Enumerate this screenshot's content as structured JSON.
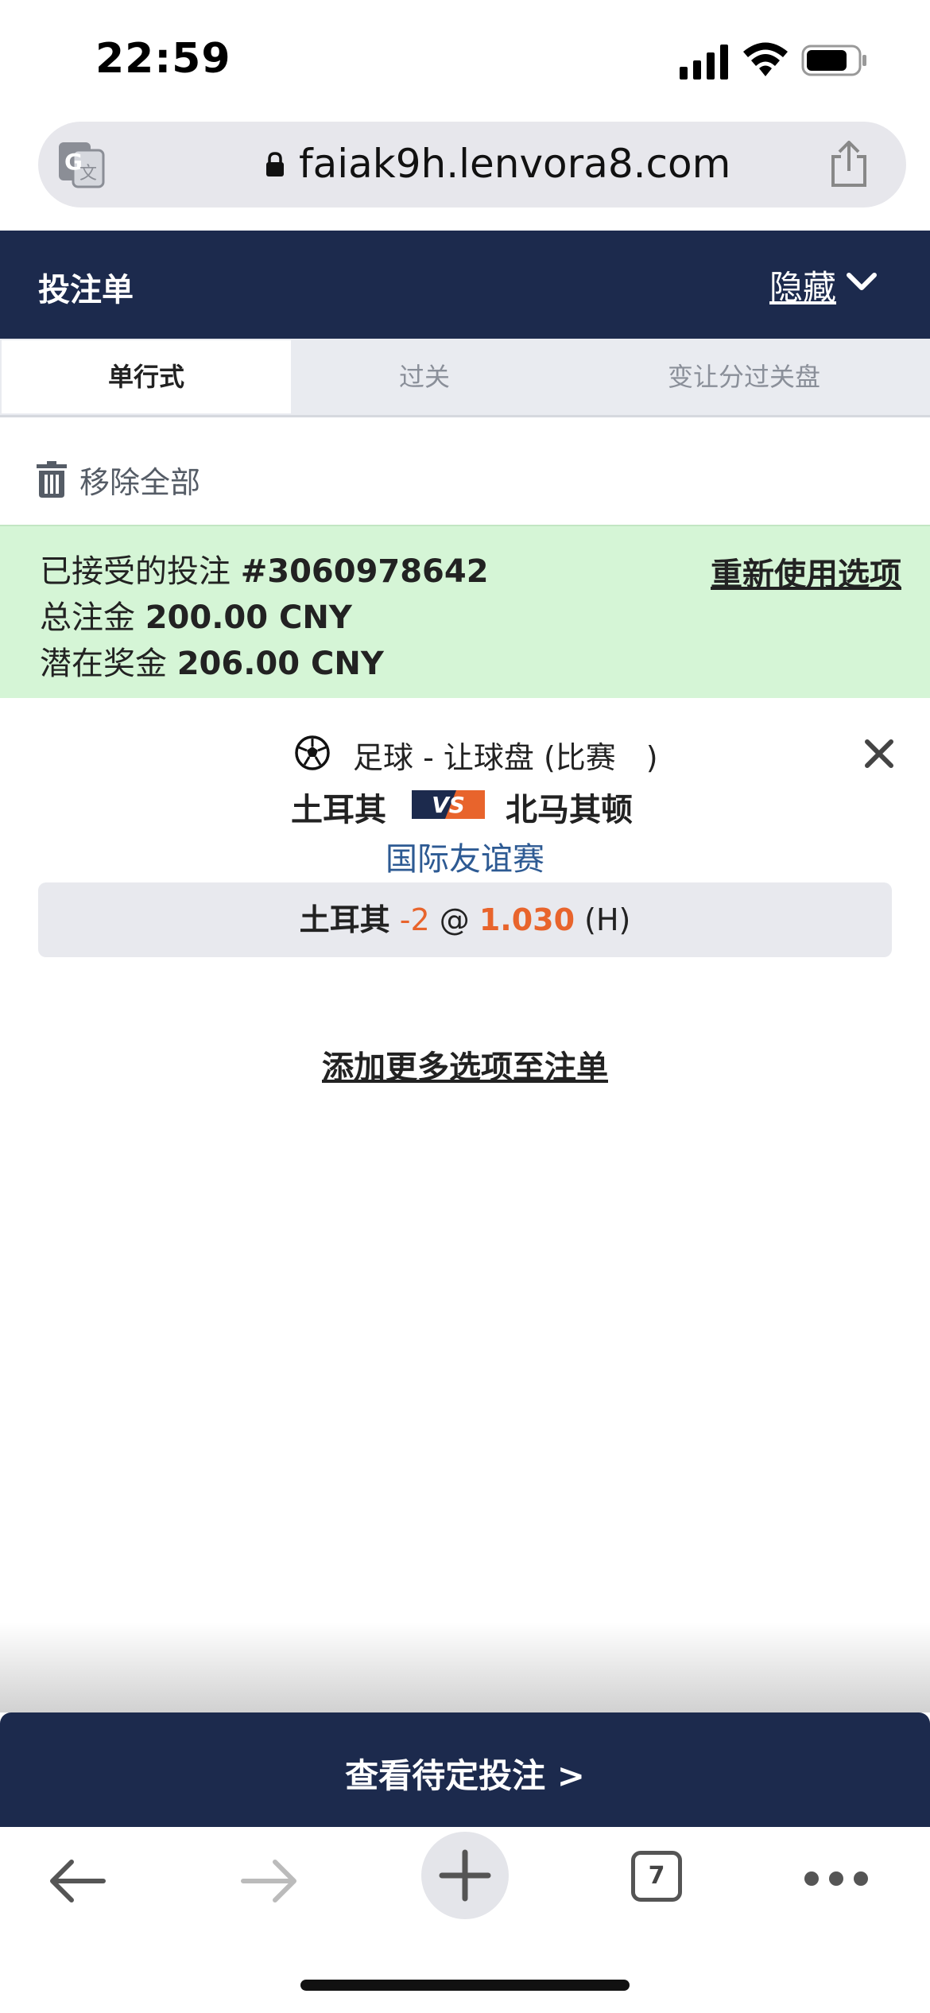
{
  "status_bar": {
    "time": "22:59"
  },
  "address_bar": {
    "url": "faiak9h.lenvora8.com"
  },
  "bet_slip": {
    "title": "投注单",
    "hide_label": "隐藏",
    "tabs": [
      {
        "label": "单行式",
        "active": true
      },
      {
        "label": "过关",
        "active": false
      },
      {
        "label": "变让分过关盘",
        "active": false
      }
    ],
    "remove_all_label": "移除全部"
  },
  "accepted": {
    "line1_prefix": "已接受的投注",
    "bet_id": "#3060978642",
    "line2_prefix": "总注金",
    "total_stake": "200.00 CNY",
    "line3_prefix": "潜在奖金",
    "potential_win": "206.00 CNY",
    "reuse_label": "重新使用选项"
  },
  "bet": {
    "sport_market": "足球 - 让球盘 (比赛　)",
    "home_team": "土耳其",
    "vs_label": "VS",
    "away_team": "北马其顿",
    "league": "国际友谊赛",
    "selection_team": "土耳其",
    "handicap": "-2",
    "at": "@",
    "odds": "1.030",
    "side": "(H)"
  },
  "add_more_label": "添加更多选项至注单",
  "pending_label": "查看待定投注 >",
  "toolbar": {
    "tab_count": "7"
  },
  "colors": {
    "navy": "#1c2a4d",
    "accepted_bg": "#d5f5d6",
    "accent_orange": "#e8642c",
    "league_blue": "#2d5a93"
  }
}
